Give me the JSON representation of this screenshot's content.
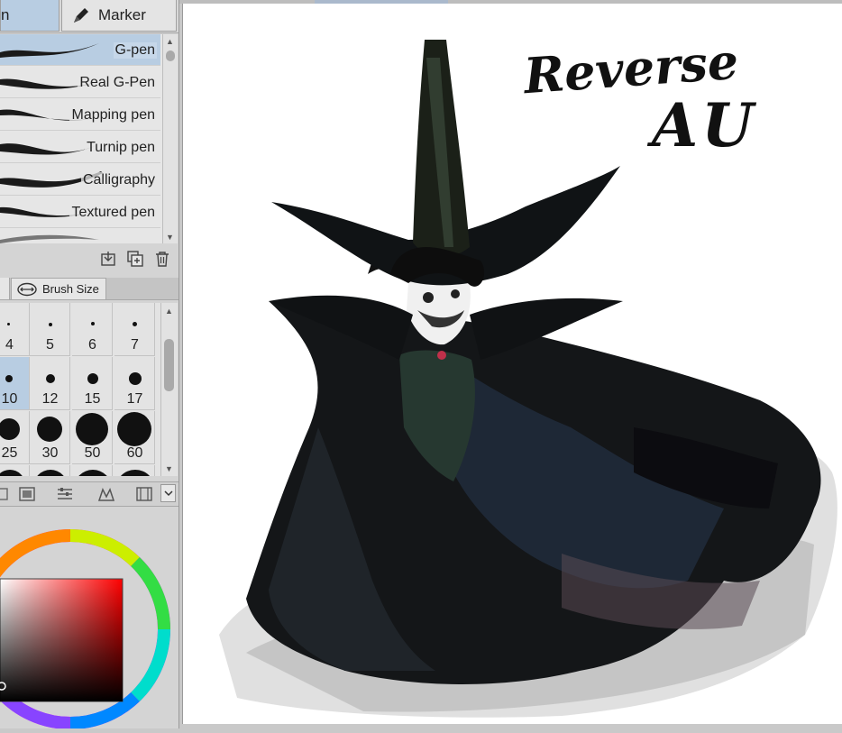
{
  "tool_tabs": {
    "active_label": "n",
    "inactive_label": "Marker"
  },
  "brushes": [
    {
      "label": "G-pen",
      "selected": true
    },
    {
      "label": "Real G-Pen",
      "selected": false
    },
    {
      "label": "Mapping pen",
      "selected": false
    },
    {
      "label": "Turnip pen",
      "selected": false
    },
    {
      "label": "Calligraphy",
      "selected": false
    },
    {
      "label": "Textured pen",
      "selected": false
    }
  ],
  "brush_actions": [
    "import-icon",
    "duplicate-icon",
    "trash-icon"
  ],
  "brush_size": {
    "tab_label": "Brush Size",
    "rows": [
      [
        "4",
        "5",
        "6",
        "7"
      ],
      [
        "10",
        "12",
        "15",
        "17"
      ],
      [
        "25",
        "30",
        "50",
        "60"
      ]
    ],
    "selected": "10"
  },
  "color": {
    "main_hue": "#ff0000"
  },
  "artwork": {
    "title_line1": "Reverse",
    "title_line2": "AU"
  }
}
